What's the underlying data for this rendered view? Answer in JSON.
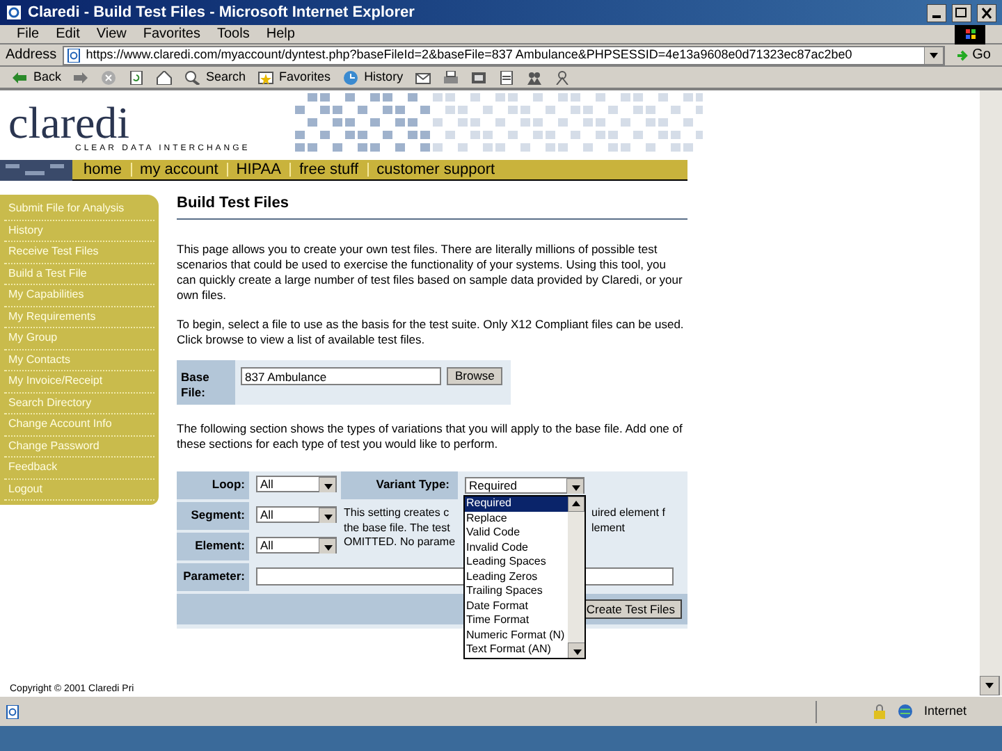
{
  "window": {
    "title": "Claredi - Build Test Files - Microsoft Internet Explorer"
  },
  "menu": [
    "File",
    "Edit",
    "View",
    "Favorites",
    "Tools",
    "Help"
  ],
  "address": {
    "label": "Address",
    "url": "https://www.claredi.com/myaccount/dyntest.php?baseFileId=2&baseFile=837 Ambulance&PHPSESSID=4e13a9608e0d71323ec87ac2be0",
    "go": "Go"
  },
  "toolbar": [
    {
      "kind": "back",
      "label": "Back"
    },
    {
      "kind": "forward"
    },
    {
      "kind": "stop"
    },
    {
      "kind": "refresh"
    },
    {
      "kind": "home"
    },
    {
      "kind": "search",
      "label": "Search"
    },
    {
      "kind": "favorites",
      "label": "Favorites"
    },
    {
      "kind": "history",
      "label": "History"
    },
    {
      "kind": "mail"
    },
    {
      "kind": "print"
    },
    {
      "kind": "edit"
    },
    {
      "kind": "discuss"
    },
    {
      "kind": "messenger"
    },
    {
      "kind": "user"
    }
  ],
  "site": {
    "logo": "claredi",
    "tagline": "CLEAR DATA INTERCHANGE",
    "nav": [
      "home",
      "my account",
      "HIPAA",
      "free stuff",
      "customer support"
    ]
  },
  "sidebar": [
    "Submit File for Analysis",
    "History",
    "Receive Test Files",
    "Build a Test File",
    "My Capabilities",
    "My Requirements",
    "My Group",
    "My Contacts",
    "My Invoice/Receipt",
    "Search Directory",
    "Change Account Info",
    "Change Password",
    "Feedback",
    "Logout"
  ],
  "main": {
    "heading": "Build Test Files",
    "intro": "This page allows you to create your own test files. There are literally millions of possible test scenarios that could be used to exercise the functionality of your systems. Using this tool, you can quickly create a large number of test files based on sample data provided by Claredi, or your own files.",
    "begin": "To begin, select a file to use as the basis for the test suite. Only X12 Compliant files can be used. Click browse to view a list of available test files.",
    "base_file": {
      "label": "Base File:",
      "value": "837 Ambulance",
      "button": "Browse"
    },
    "variations": "The following section shows the types of variations that you will apply to the base file. Add one of these sections for each type of test you would like to perform.",
    "form": {
      "loop": {
        "label": "Loop:",
        "value": "All"
      },
      "variant_type": {
        "label": "Variant Type:",
        "value": "Required"
      },
      "segment": {
        "label": "Segment:",
        "value": "All"
      },
      "element": {
        "label": "Element:",
        "value": "All"
      },
      "parameter": {
        "label": "Parameter:"
      },
      "description_left": [
        "This setting creates c",
        "the base file. The test",
        "OMITTED. No parame"
      ],
      "description_right": [
        "uired element f",
        "lement"
      ],
      "button": "Create Test Files",
      "options": [
        {
          "label": "Required",
          "selected": true
        },
        {
          "label": "Replace",
          "selected": false
        },
        {
          "label": "Valid Code",
          "selected": false
        },
        {
          "label": "Invalid Code",
          "selected": false
        },
        {
          "label": "Leading Spaces",
          "selected": false
        },
        {
          "label": "Leading Zeros",
          "selected": false
        },
        {
          "label": "Trailing Spaces",
          "selected": false
        },
        {
          "label": "Date Format",
          "selected": false
        },
        {
          "label": "Time Format",
          "selected": false
        },
        {
          "label": "Numeric Format (N)",
          "selected": false
        },
        {
          "label": "Text Format (AN)",
          "selected": false
        }
      ]
    },
    "copyright": "Copyright © 2001 Claredi Pri"
  },
  "status_bar": {
    "zone": "Internet"
  }
}
